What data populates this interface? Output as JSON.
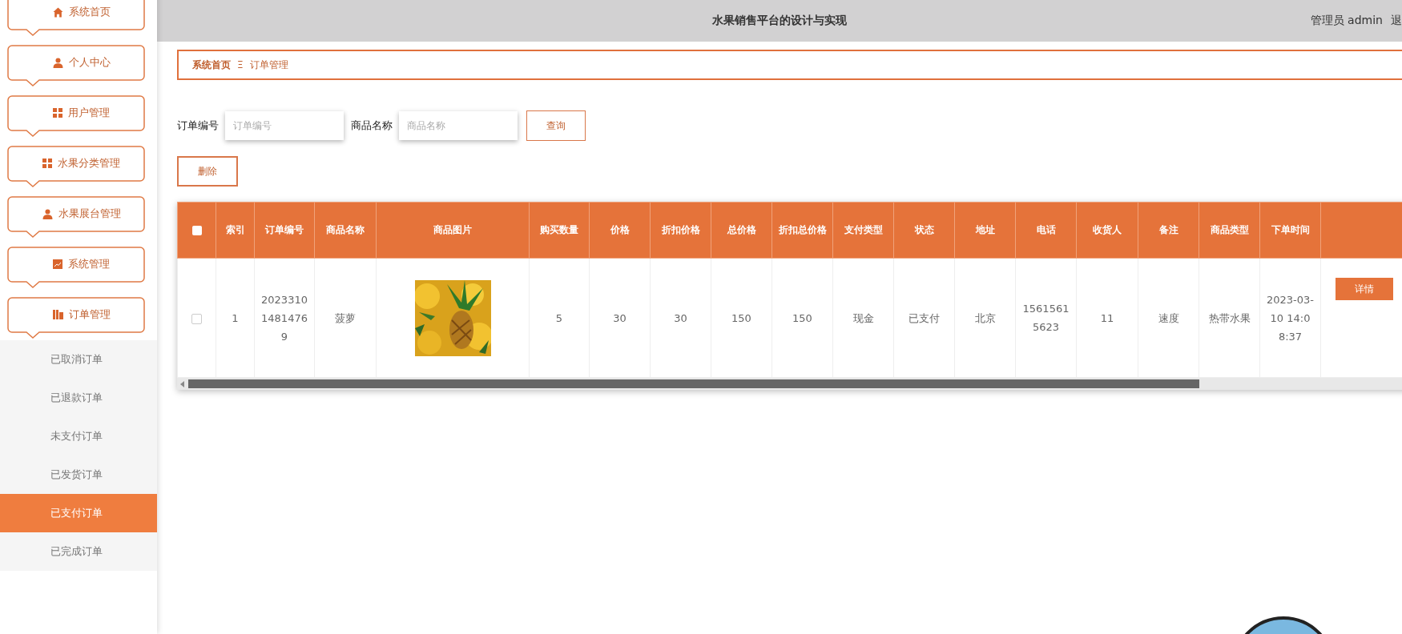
{
  "sidebar": {
    "items": [
      {
        "label": "系统首页"
      },
      {
        "label": "个人中心"
      },
      {
        "label": "用户管理"
      },
      {
        "label": "水果分类管理"
      },
      {
        "label": "水果展台管理"
      },
      {
        "label": "系统管理"
      },
      {
        "label": "订单管理",
        "expanded": true,
        "children": [
          {
            "label": "已取消订单",
            "selected": false
          },
          {
            "label": "已退款订单",
            "selected": false
          },
          {
            "label": "未支付订单",
            "selected": false
          },
          {
            "label": "已发货订单",
            "selected": false
          },
          {
            "label": "已支付订单",
            "selected": true
          },
          {
            "label": "已完成订单",
            "selected": false
          }
        ]
      }
    ]
  },
  "header": {
    "title": "水果销售平台的设计与实现",
    "user": "管理员 admin",
    "logout": "退"
  },
  "breadcrumb": {
    "home": "系统首页",
    "separator": "Ξ",
    "current": "订单管理"
  },
  "search": {
    "fields": [
      {
        "label": "订单编号",
        "placeholder": "订单编号"
      },
      {
        "label": "商品名称",
        "placeholder": "商品名称"
      }
    ],
    "button": "查询"
  },
  "delete_button": "删除",
  "table": {
    "select_all_checked": false,
    "columns": [
      "索引",
      "订单编号",
      "商品名称",
      "商品图片",
      "购买数量",
      "价格",
      "折扣价格",
      "总价格",
      "折扣总价格",
      "支付类型",
      "状态",
      "地址",
      "电话",
      "收货人",
      "备注",
      "商品类型",
      "下单时间"
    ],
    "rows": [
      {
        "checked": false,
        "cells": [
          "1",
          "202331014814769",
          "菠萝",
          {
            "kind": "picture"
          },
          "5",
          "30",
          "30",
          "150",
          "150",
          "现金",
          "已支付",
          "北京",
          "15615615623",
          "11",
          "速度",
          "热带水果",
          "2023-03-10 14:08:37"
        ],
        "action": "详情"
      }
    ]
  }
}
